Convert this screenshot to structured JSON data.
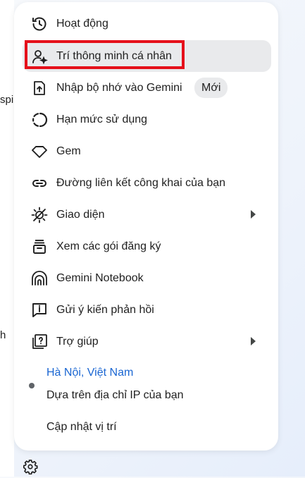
{
  "background": {
    "left_fragment_1": "spir",
    "left_fragment_2": "h"
  },
  "menu": {
    "items": [
      {
        "label": "Hoạt động",
        "icon": "history-icon"
      },
      {
        "label": "Trí thông minh cá nhân",
        "icon": "personal-intelligence-icon",
        "active": true,
        "highlighted": true
      },
      {
        "label": "Nhập bộ nhớ vào Gemini",
        "icon": "import-memory-icon",
        "badge": "Mới"
      },
      {
        "label": "Hạn mức sử dụng",
        "icon": "usage-limit-icon"
      },
      {
        "label": "Gem",
        "icon": "gem-icon"
      },
      {
        "label": "Đường liên kết công khai của bạn",
        "icon": "link-icon"
      },
      {
        "label": "Giao diện",
        "icon": "theme-icon",
        "submenu": true
      },
      {
        "label": "Xem các gói đăng ký",
        "icon": "subscription-icon"
      },
      {
        "label": "Gemini Notebook",
        "icon": "notebook-icon"
      },
      {
        "label": "Gửi ý kiến phản hồi",
        "icon": "feedback-icon"
      },
      {
        "label": "Trợ giúp",
        "icon": "help-icon",
        "submenu": true
      }
    ],
    "location": {
      "city": "Hà Nội, Việt Nam",
      "source": "Dựa trên địa chỉ IP của bạn",
      "update": "Cập nhật vị trí"
    }
  },
  "colors": {
    "highlight": "#e5101a",
    "link": "#1a66d2",
    "active_bg": "#e9eaec"
  }
}
